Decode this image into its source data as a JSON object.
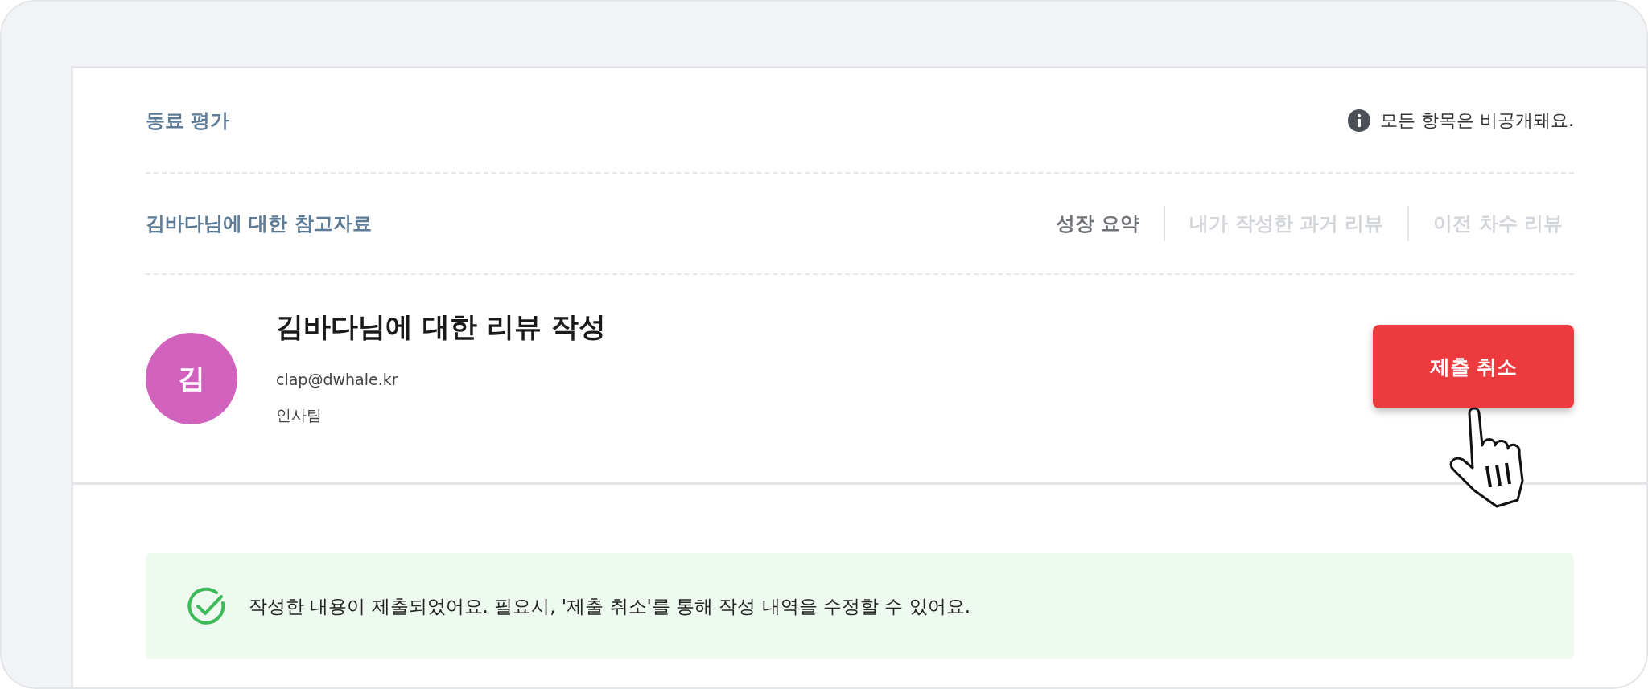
{
  "header": {
    "title": "동료 평가",
    "notice": "모든 항목은 비공개돼요."
  },
  "references": {
    "title": "김바다님에 대한 참고자료",
    "tabs": [
      {
        "label": "성장 요약",
        "selected": true
      },
      {
        "label": "내가 작성한 과거 리뷰",
        "selected": false
      },
      {
        "label": "이전 차수 리뷰",
        "selected": false
      }
    ]
  },
  "profile": {
    "initial": "김",
    "title": "김바다님에 대한 리뷰 작성",
    "email": "clap@dwhale.kr",
    "team": "인사팀"
  },
  "action_button": {
    "label": "제출 취소"
  },
  "banner": {
    "message": "작성한 내용이 제출되었어요. 필요시, '제출 취소'를 통해 작성 내역을 수정할 수 있어요."
  }
}
